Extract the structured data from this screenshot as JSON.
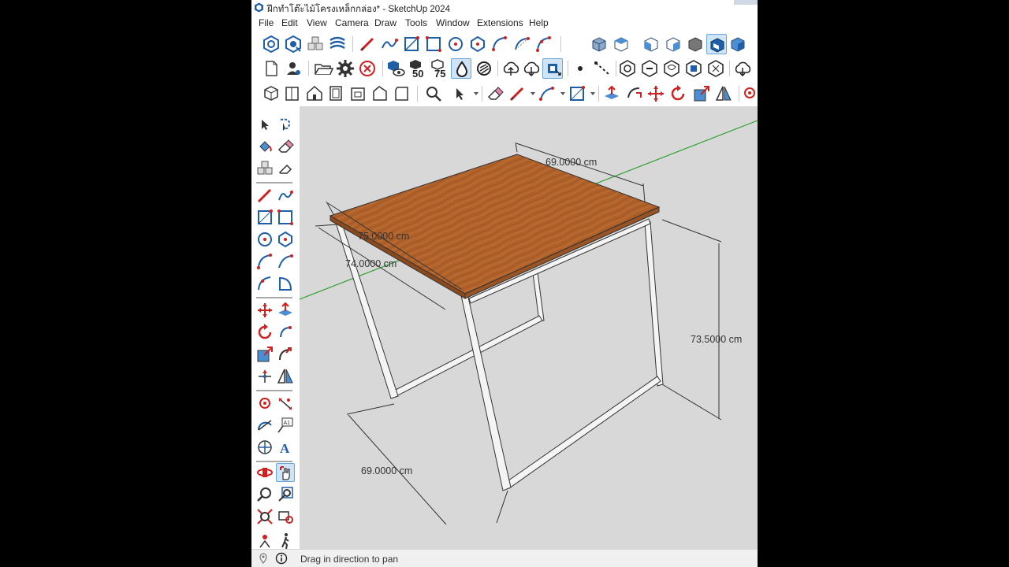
{
  "window": {
    "title": "ฝึกทำโต๊ะไม้โครงเหล็กกล่อง* - SketchUp 2024"
  },
  "menu": [
    "File",
    "Edit",
    "View",
    "Camera",
    "Draw",
    "Tools",
    "Window",
    "Extensions",
    "Help"
  ],
  "toolbars": {
    "row1": [
      "styles-xray-icon",
      "styles-back-edges-icon",
      "components-icon",
      "sandbox-icon",
      "pencil-line-icon",
      "freehand-icon",
      "rectangle-icon",
      "rotated-rectangle-icon",
      "circle-icon",
      "polygon-icon",
      "arc-icon",
      "two-point-arc-icon",
      "three-point-arc-icon",
      "iso-view-icon",
      "top-view-icon",
      "front-view-icon",
      "right-view-icon",
      "back-view-icon",
      "left-view-icon",
      "bottom-view-icon"
    ],
    "row2": [
      "new-file-icon",
      "account-icon",
      "open-folder-icon",
      "settings-gear-icon",
      "cancel-icon",
      "preview-icon",
      "fifty-icon",
      "seventy-five-icon",
      "drop-icon",
      "no-entry-icon",
      "cloud-upload-icon",
      "cloud-download-icon",
      "cloud-share-icon",
      "dot-icon",
      "dashed-line-icon",
      "solid-tools-icon"
    ],
    "row3": [
      "components-box-icon",
      "window-icon",
      "house-icon",
      "door-icon",
      "frame-icon",
      "roof-icon",
      "wall-icon",
      "zoom-icon",
      "select-icon",
      "eraser-icon",
      "pencil-icon",
      "line-tool-icon",
      "rectangle-tool-icon",
      "push-pull-icon",
      "follow-me-icon",
      "move-icon",
      "rotate-icon",
      "scale-icon",
      "flip-icon",
      "paint-bucket-icon"
    ]
  },
  "viewport": {
    "dimensions": {
      "top_width": "69.0000 cm",
      "top_depth_outer": "75.0000 cm",
      "top_depth_inner": "74.0000 cm",
      "height": "73.5000 cm",
      "bottom_width": "69.0000 cm"
    },
    "colors": {
      "background": "#d8d8d8",
      "tabletop": "#b0622a",
      "frame": "#f4f4f4",
      "green_axis": "#2aa02a"
    }
  },
  "status": {
    "text": "Drag in direction to pan"
  }
}
